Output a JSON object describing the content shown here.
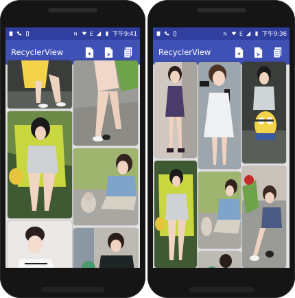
{
  "left_phone": {
    "status": {
      "time": "下午9:41",
      "carrier_icons": [
        "sim-icon",
        "call-icon",
        "vibrate-icon"
      ],
      "right_icons": [
        "nfc-icon",
        "wifi-icon",
        "signal-e-icon",
        "battery-icon"
      ],
      "network": "E"
    },
    "toolbar": {
      "title": "RecyclerView",
      "actions": [
        "add-doc-icon",
        "copy-doc-icon",
        "stack-doc-icon"
      ]
    }
  },
  "right_phone": {
    "status": {
      "time": "下午9:36",
      "carrier_icons": [
        "sim-icon",
        "call-icon",
        "vibrate-icon"
      ],
      "right_icons": [
        "nfc-icon",
        "wifi-icon",
        "signal-e-icon",
        "battery-icon"
      ],
      "network": "E"
    },
    "toolbar": {
      "title": "RecyclerView",
      "actions": [
        "add-doc-icon",
        "copy-doc-icon",
        "stack-doc-icon"
      ]
    }
  },
  "colors": {
    "status_bar": "#303f9f",
    "toolbar": "#3f51b5",
    "grid_bg": "#e6e6e6"
  }
}
